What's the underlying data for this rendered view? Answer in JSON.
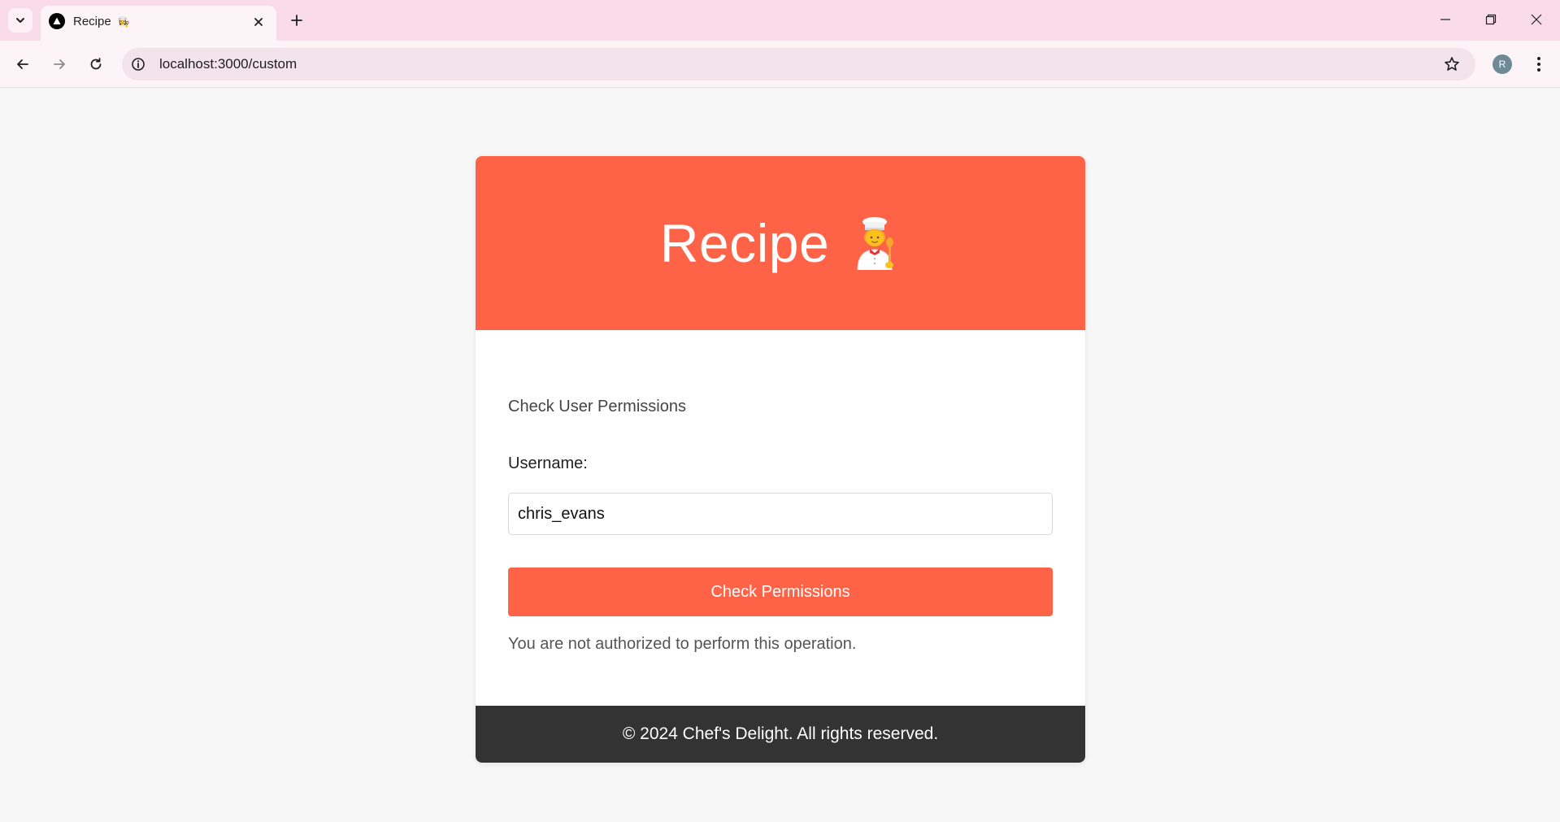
{
  "browser": {
    "tab": {
      "title": "Recipe",
      "emoji": "👩‍🍳"
    },
    "address_bar": {
      "url": "localhost:3000/custom"
    },
    "profile_initial": "R"
  },
  "page": {
    "header": {
      "title": "Recipe",
      "icon": "chef-icon",
      "color": "#ff6347"
    },
    "section_label": "Check User Permissions",
    "username_label": "Username:",
    "username_value": "chris_evans",
    "check_button_label": "Check Permissions",
    "result_message": "You are not authorized to perform this operation.",
    "footer": {
      "text": "© 2024 Chef's Delight. All rights reserved.",
      "color": "#333333"
    }
  }
}
